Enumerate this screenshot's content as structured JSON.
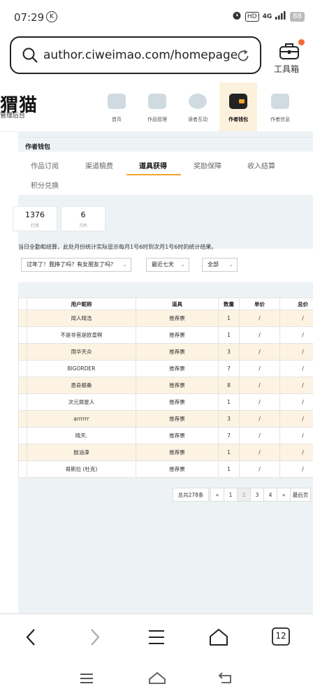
{
  "status_bar": {
    "time": "07:29",
    "k_label": "K",
    "hd": "HD",
    "network": "4G",
    "battery": "88"
  },
  "browser": {
    "url": "author.ciweimao.com/homepage",
    "toolbox_label": "工具箱",
    "tab_count": "12"
  },
  "site": {
    "logo": "刺猬猫",
    "logo_display": "猬猫",
    "logo_sub": "管理后台",
    "nav": [
      {
        "label": "首页"
      },
      {
        "label": "作品管理"
      },
      {
        "label": "读者互动"
      },
      {
        "label": "作者钱包"
      },
      {
        "label": "作者信息"
      }
    ]
  },
  "wallet": {
    "title": "作者钱包",
    "tabs": [
      "作品订阅",
      "渠道稿费",
      "道具获得",
      "奖励保障",
      "收入结算",
      "积分兑换"
    ],
    "active_tab": "道具获得",
    "stats": [
      {
        "value": "1376",
        "label": "打赏"
      },
      {
        "value": "6",
        "label": "刀片"
      }
    ],
    "notice": "当日全勤和结算，此处月份统计实际显示每月1号6时到次月1号6时的统计结果。",
    "filters": {
      "book": "过年了！我挣了吗？有女朋友了吗？",
      "range": "最近七天",
      "type": "全部"
    },
    "table": {
      "headers": [
        "用户昵称",
        "道具",
        "数量",
        "单价",
        "总价"
      ],
      "rows": [
        [
          "闻人晴浩",
          "推荐票",
          "1",
          "/",
          "/"
        ],
        [
          "不是非首是欧皇啊",
          "推荐票",
          "1",
          "/",
          "/"
        ],
        [
          "雨华天众",
          "推荐票",
          "3",
          "/",
          "/"
        ],
        [
          "BIGORDER",
          "推荐票",
          "7",
          "/",
          "/"
        ],
        [
          "恩奇都桑",
          "推荐票",
          "8",
          "/",
          "/"
        ],
        [
          "次元屑星人",
          "推荐票",
          "1",
          "/",
          "/"
        ],
        [
          "arrrrrr",
          "推荐票",
          "3",
          "/",
          "/"
        ],
        [
          "晴天.",
          "推荐票",
          "7",
          "/",
          "/"
        ],
        [
          "肢油津",
          "推荐票",
          "1",
          "/",
          "/"
        ],
        [
          "哥斯拉 (杜克)",
          "推荐票",
          "1",
          "/",
          "/"
        ]
      ]
    },
    "pagination": {
      "total": "总共278条",
      "prev": "«",
      "pages": [
        "1",
        "2",
        "3",
        "4"
      ],
      "current": "2",
      "next": "»",
      "last": "最后页"
    }
  },
  "colors": {
    "accent": "#f0a530",
    "row_highlight": "#fcf3e3",
    "content_bg": "#edf3f5",
    "badge": "#f26b3a"
  },
  "icons": [
    "search-icon",
    "reload-icon",
    "toolbox-icon",
    "back-icon",
    "forward-icon",
    "menu-icon",
    "home-icon",
    "tabs-icon"
  ]
}
